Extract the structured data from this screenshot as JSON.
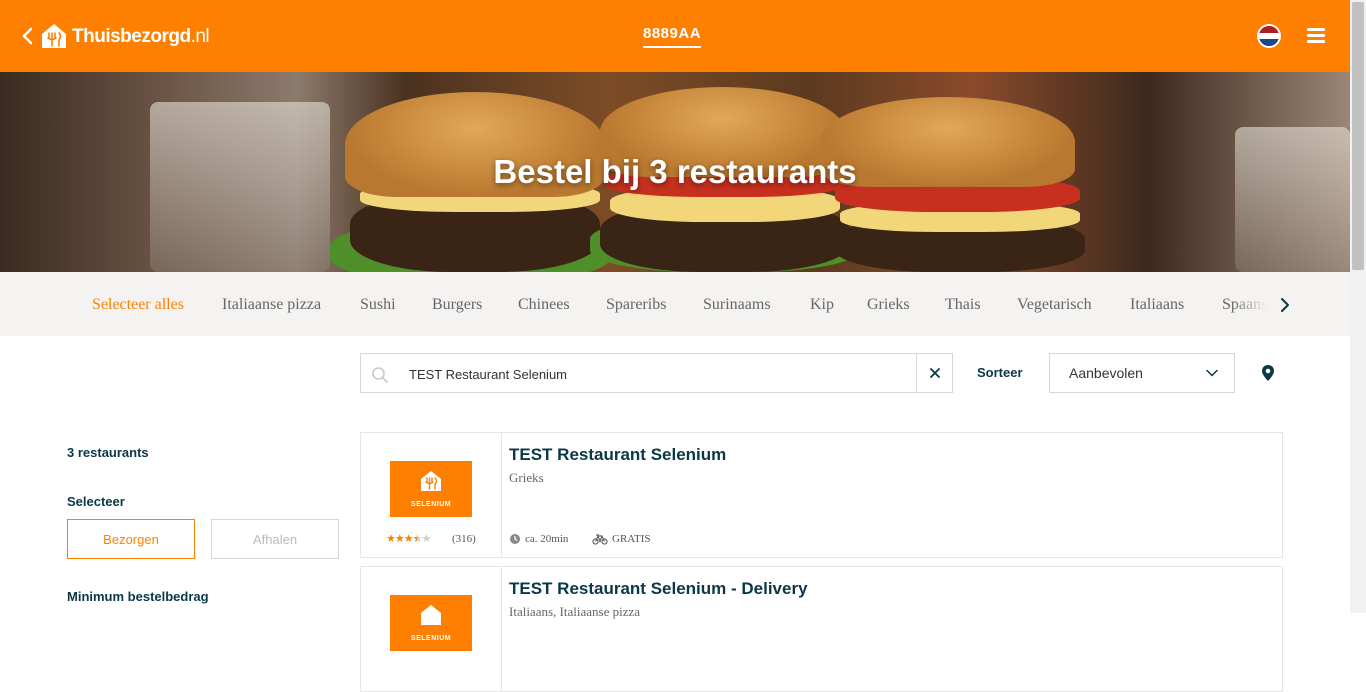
{
  "header": {
    "logo_main": "Thuisbezorgd",
    "logo_tld": ".nl",
    "postcode": "8889AA",
    "colors": {
      "brand": "#ff8000",
      "text_dark": "#0a3847"
    }
  },
  "hero": {
    "title": "Bestel bij 3 restaurants"
  },
  "categories": [
    "Selecteer alles",
    "Italiaanse pizza",
    "Sushi",
    "Burgers",
    "Chinees",
    "Spareribs",
    "Surinaams",
    "Kip",
    "Grieks",
    "Thais",
    "Vegetarisch",
    "Italiaans",
    "Spaans"
  ],
  "search": {
    "value": "TEST Restaurant Selenium",
    "sort_label": "Sorteer",
    "sort_value": "Aanbevolen"
  },
  "sidebar": {
    "count": "3 restaurants",
    "select_label": "Selecteer",
    "delivery_label": "Bezorgen",
    "pickup_label": "Afhalen",
    "minimum_label": "Minimum bestelbedrag"
  },
  "restaurants": [
    {
      "name": "TEST Restaurant Selenium",
      "cuisine": "Grieks",
      "logo_text": "SELENIUM",
      "rating": 3.5,
      "review_count": "(316)",
      "delivery_time": "ca. 20min",
      "delivery_cost": "GRATIS"
    },
    {
      "name": "TEST Restaurant Selenium - Delivery",
      "cuisine": "Italiaans, Italiaanse pizza",
      "logo_text": "SELENIUM"
    }
  ]
}
